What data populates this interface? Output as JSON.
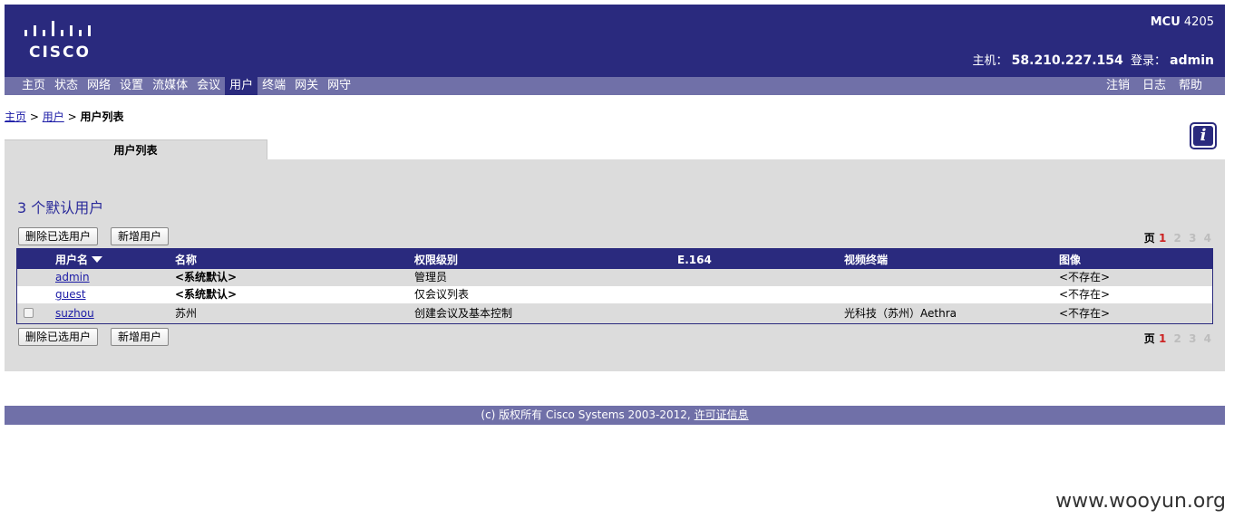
{
  "header": {
    "logo_text": "CISCO",
    "product_name": "MCU",
    "product_model": "4205",
    "host_label": "主机：",
    "host_value": "58.210.227.154",
    "login_label": "登录：",
    "login_value": "admin",
    "background_color": "#2a2a7e"
  },
  "nav": {
    "left": [
      "主页",
      "状态",
      "网络",
      "设置",
      "流媒体",
      "会议",
      "用户",
      "终端",
      "网关",
      "网守"
    ],
    "active": "用户",
    "right": [
      "注销",
      "日志",
      "帮助"
    ],
    "background_color": "#7070a8"
  },
  "breadcrumb": {
    "home": "主页",
    "sep1": ">",
    "users": "用户",
    "sep2": ">",
    "current": "用户列表"
  },
  "info_icon": "info-icon",
  "tab": {
    "label": "用户列表"
  },
  "panel": {
    "title": "3 个默认用户",
    "delete_button": "删除已选用户",
    "add_button": "新增用户",
    "pager": {
      "label": "页",
      "current": "1",
      "pages": [
        "2",
        "3",
        "4"
      ]
    }
  },
  "table": {
    "headers": {
      "username": "用户名",
      "name": "名称",
      "level": "权限级别",
      "e164": "E.164",
      "video": "视频终端",
      "image": "图像"
    },
    "sort_icon": "sort-down-icon",
    "rows": [
      {
        "username": "admin",
        "name": "<系统默认>",
        "level": "管理员",
        "e164": "",
        "video": "",
        "image": "<不存在>"
      },
      {
        "username": "guest",
        "name": "<系统默认>",
        "level": "仅会议列表",
        "e164": "",
        "video": "",
        "image": "<不存在>"
      },
      {
        "username": "suzhou",
        "name": "苏州",
        "level": "创建会议及基本控制",
        "e164": "",
        "video": "光科技（苏州）Aethra",
        "image": "<不存在>"
      }
    ]
  },
  "footer": {
    "text": "(c) 版权所有 Cisco Systems 2003-2012,",
    "link": "许可证信息"
  },
  "watermark": "www.wooyun.org"
}
